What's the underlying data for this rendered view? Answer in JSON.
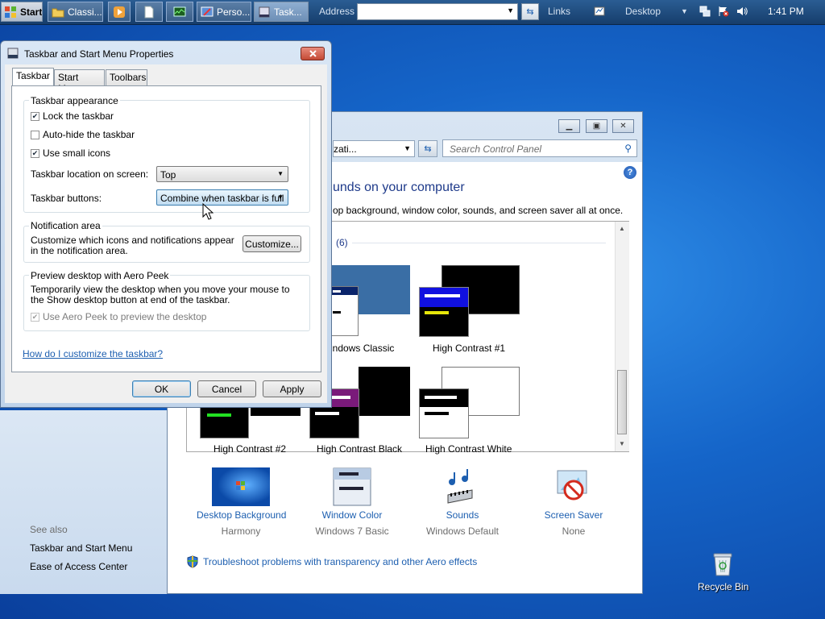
{
  "taskbar": {
    "start_label": "Start",
    "buttons": [
      {
        "label": "Classi...",
        "icon": "folder-icon"
      },
      {
        "label": "",
        "icon": "media-player-icon"
      },
      {
        "label": "",
        "icon": "document-icon"
      },
      {
        "label": "",
        "icon": "task-manager-icon"
      },
      {
        "label": "Perso...",
        "icon": "personalization-icon"
      },
      {
        "label": "Task...",
        "icon": "taskbar-properties-icon"
      }
    ],
    "address_label": "Address",
    "address_value": "",
    "links_label": "Links",
    "desktop_label": "Desktop",
    "clock": "1:41 PM"
  },
  "control_panel": {
    "breadcrumb_fragment": "zati...",
    "search_placeholder": "Search Control Panel",
    "heading": "unds on your computer",
    "subtext": "op background, window color, sounds, and screen saver all at once.",
    "group_count": "(6)",
    "themes": [
      {
        "name": "indows Classic"
      },
      {
        "name": "High Contrast #1"
      },
      {
        "name": "High Contrast #2"
      },
      {
        "name": "High Contrast Black"
      },
      {
        "name": "High Contrast White"
      }
    ],
    "items": [
      {
        "title": "Desktop Background",
        "sub": "Harmony"
      },
      {
        "title": "Window Color",
        "sub": "Windows 7 Basic"
      },
      {
        "title": "Sounds",
        "sub": "Windows Default"
      },
      {
        "title": "Screen Saver",
        "sub": "None"
      }
    ],
    "troubleshoot_link": "Troubleshoot problems with transparency and other Aero effects",
    "see_also": {
      "title": "See also",
      "links": [
        "Taskbar and Start Menu",
        "Ease of Access Center"
      ]
    },
    "colors": {
      "link": "#1d5fb0",
      "heading": "#1e3a8a"
    }
  },
  "dialog": {
    "title": "Taskbar and Start Menu Properties",
    "close_label": "x",
    "tabs": [
      "Taskbar",
      "Start Menu",
      "Toolbars"
    ],
    "appearance": {
      "title": "Taskbar appearance",
      "lock": {
        "label": "Lock the taskbar",
        "checked": true
      },
      "autohide": {
        "label": "Auto-hide the taskbar",
        "checked": false
      },
      "small_icons": {
        "label": "Use small icons",
        "checked": true
      },
      "location_label": "Taskbar location on screen:",
      "location_value": "Top",
      "buttons_label": "Taskbar buttons:",
      "buttons_value": "Combine when taskbar is full"
    },
    "notification": {
      "title": "Notification area",
      "desc": "Customize which icons and notifications appear in the notification area.",
      "customize_label": "Customize..."
    },
    "aero_peek": {
      "title": "Preview desktop with Aero Peek",
      "desc": "Temporarily view the desktop when you move your mouse to the Show desktop button at end of the taskbar.",
      "checkbox": {
        "label": "Use Aero Peek to preview the desktop",
        "checked": true,
        "disabled": true
      }
    },
    "help_link": "How do I customize the taskbar?",
    "ok_label": "OK",
    "cancel_label": "Cancel",
    "apply_label": "Apply"
  },
  "desktop": {
    "recycle_bin_label": "Recycle Bin"
  }
}
